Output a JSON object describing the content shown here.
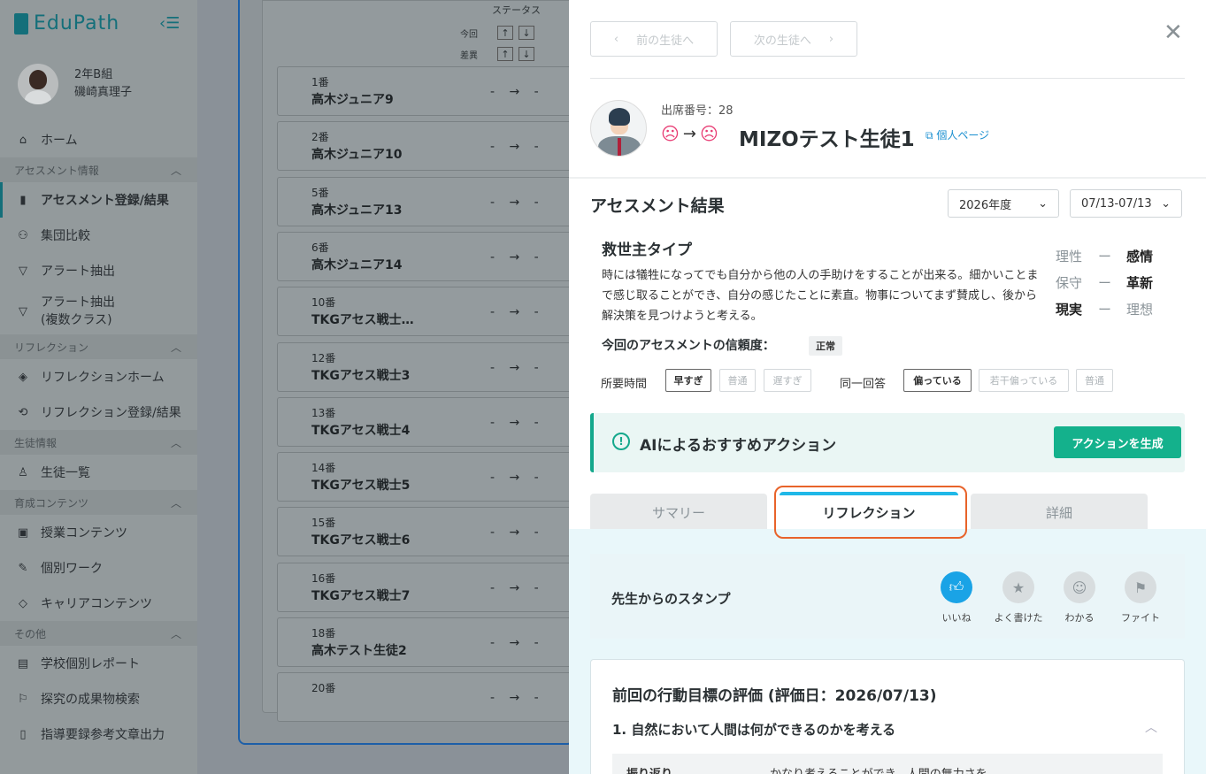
{
  "app": {
    "name": "EduPath"
  },
  "user": {
    "class": "2年B組",
    "name": "磯崎真理子"
  },
  "sidebar": {
    "home": "ホーム",
    "sections": [
      {
        "label": "アセスメント情報",
        "items": [
          "アセスメント登録/結果",
          "集団比較",
          "アラート抽出",
          "アラート抽出\n(複数クラス)"
        ]
      },
      {
        "label": "リフレクション",
        "items": [
          "リフレクションホーム",
          "リフレクション登録/結果"
        ]
      },
      {
        "label": "生徒情報",
        "items": [
          "生徒一覧"
        ]
      },
      {
        "label": "育成コンテンツ",
        "items": [
          "授業コンテンツ",
          "個別ワーク",
          "キャリアコンテンツ"
        ]
      },
      {
        "label": "その他",
        "items": [
          "学校個別レポート",
          "探究の成果物検索",
          "指導要録参考文章出力"
        ]
      }
    ]
  },
  "list": {
    "status_header": "ステータス",
    "sort_now": "今回",
    "sort_diff": "差異",
    "students": [
      {
        "num": "1番",
        "name": "高木ジュニア9",
        "status": "- → -"
      },
      {
        "num": "2番",
        "name": "高木ジュニア10",
        "status": "- → -"
      },
      {
        "num": "5番",
        "name": "高木ジュニア13",
        "status": "- → -"
      },
      {
        "num": "6番",
        "name": "高木ジュニア14",
        "status": "- → -"
      },
      {
        "num": "10番",
        "name": "TKGアセス戦士…",
        "status": "- → -"
      },
      {
        "num": "12番",
        "name": "TKGアセス戦士3",
        "status": "- → -"
      },
      {
        "num": "13番",
        "name": "TKGアセス戦士4",
        "status": "- → -"
      },
      {
        "num": "14番",
        "name": "TKGアセス戦士5",
        "status": "- → -"
      },
      {
        "num": "15番",
        "name": "TKGアセス戦士6",
        "status": "- → -"
      },
      {
        "num": "16番",
        "name": "TKGアセス戦士7",
        "status": "- → -"
      },
      {
        "num": "18番",
        "name": "高木テスト生徒2",
        "status": "- → -"
      },
      {
        "num": "20番",
        "name": "",
        "status": "- → -"
      }
    ]
  },
  "drawer": {
    "prev": "前の生徒へ",
    "next": "次の生徒へ",
    "seat": "出席番号：28",
    "student_name": "MIZOテスト生徒1",
    "personal_link": "個人ページ",
    "assessment_title": "アセスメント結果",
    "year": "2026年度",
    "period": "07/13-07/13",
    "type_name": "救世主タイプ",
    "type_desc": "時には犠牲になってでも自分から他の人の手助けをすることが出来る。細かいことまで感じ取ることができ、自分の感じたことに素直。物事についてまず賛成し、後から解決策を見つけようと考える。",
    "axes": [
      {
        "left": "理性",
        "right": "感情",
        "bold": "right"
      },
      {
        "left": "保守",
        "right": "革新",
        "bold": "right"
      },
      {
        "left": "現実",
        "right": "理想",
        "bold": "left"
      }
    ],
    "dash": "ー",
    "reliability_label": "今回のアセスメントの信頼度：",
    "reliability_value": "正常",
    "time_label": "所要時間",
    "time_chips": [
      "早すぎ",
      "普通",
      "遅すぎ"
    ],
    "same_label": "同一回答",
    "same_chips": [
      "偏っている",
      "若干偏っている",
      "普通"
    ],
    "ai_title": "AIによるおすすめアクション",
    "ai_button": "アクションを生成",
    "tabs": [
      "サマリー",
      "リフレクション",
      "詳細"
    ],
    "stamp_title": "先生からのスタンプ",
    "stamps": [
      "いいね",
      "よく書けた",
      "わかる",
      "ファイト"
    ],
    "eval_title": "前回の行動目標の評価 (評価日：2026/07/13)",
    "goal1": "1. 自然において人間は何ができるのかを考える",
    "refl_key": "振り返り",
    "refl_val": "かなり考えることができ、人間の無力さを"
  }
}
